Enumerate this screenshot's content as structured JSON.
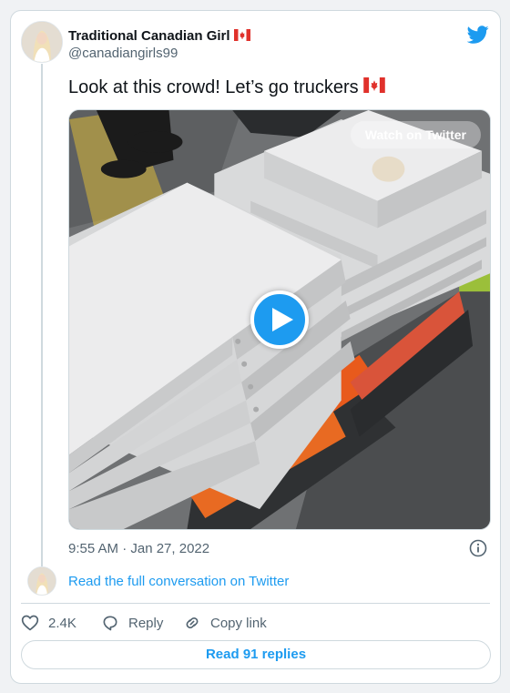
{
  "colors": {
    "accent": "#1d9bf0",
    "text": "#0f1419",
    "muted": "#536471",
    "border": "#cfd9de"
  },
  "author": {
    "name": "Traditional Canadian Girl",
    "name_flag_icon": "canada-flag-icon",
    "handle": "@canadiangirls99",
    "avatar_icon": "profile-avatar"
  },
  "brand_icon": "twitter-bird-icon",
  "tweet": {
    "text": "Look at this crowd! Let’s go truckers",
    "text_flag_icon": "canada-flag-icon"
  },
  "media": {
    "overlay_label": "Watch on Twitter",
    "play_icon": "play-icon"
  },
  "timestamp": "9:55 AM · Jan 27, 2022",
  "info_icon": "info-icon",
  "conversation_link": "Read the full conversation on Twitter",
  "actions": {
    "like_count": "2.4K",
    "reply_label": "Reply",
    "copy_label": "Copy link"
  },
  "read_replies_label": "Read 91 replies"
}
